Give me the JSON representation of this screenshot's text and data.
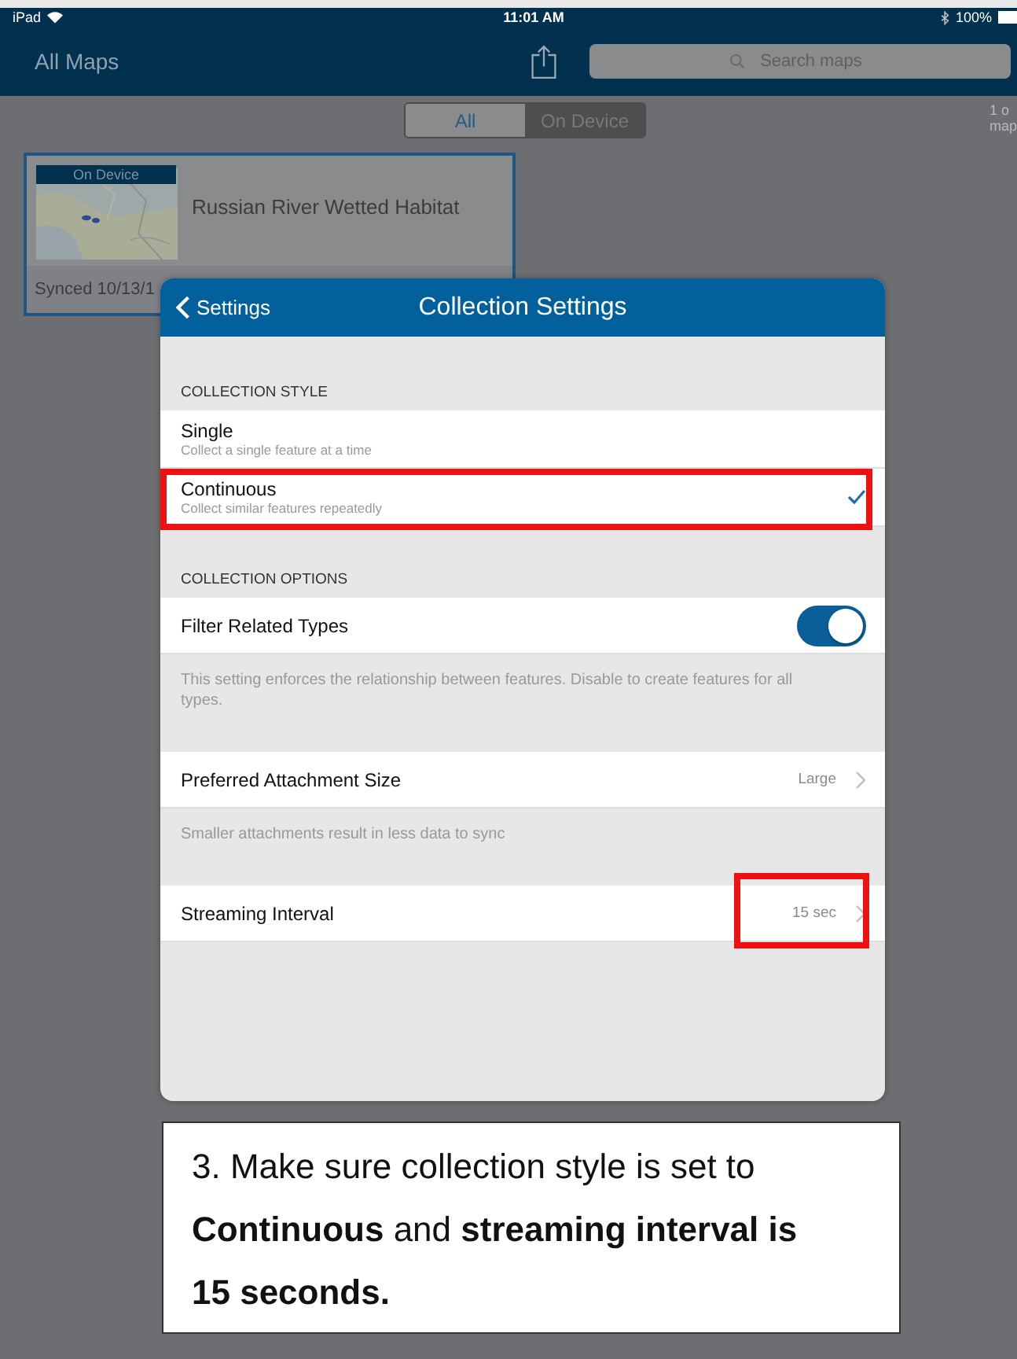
{
  "status_bar": {
    "device": "iPad",
    "time": "11:01 AM",
    "battery": "100%"
  },
  "nav_bar": {
    "title": "All Maps",
    "search": {
      "placeholder": "Search maps"
    }
  },
  "segments": [
    {
      "label": "All",
      "selected": true
    },
    {
      "label": "On Device",
      "selected": false
    }
  ],
  "side_note": [
    "1 o",
    "map"
  ],
  "map_card": {
    "badge": "On Device",
    "title": "Russian River Wetted Habitat",
    "synced": "Synced 10/13/1"
  },
  "dialog": {
    "back": "Settings",
    "title": "Collection Settings",
    "style_header": "COLLECTION STYLE",
    "styles": [
      {
        "label": "Single",
        "description": "Collect a single feature at a time",
        "selected": false,
        "highlighted": false
      },
      {
        "label": "Continuous",
        "description": "Collect similar features repeatedly",
        "selected": true,
        "highlighted": true
      }
    ],
    "options_header": "COLLECTION OPTIONS",
    "options": [
      {
        "kind": "toggle",
        "label": "Filter Related Types",
        "on": true,
        "note": "This setting enforces the relationship between features. Disable to create features for all types."
      },
      {
        "kind": "link",
        "label": "Preferred Attachment Size",
        "value": "Large",
        "highlighted": false,
        "note": "Smaller attachments result in less data to sync"
      },
      {
        "kind": "link",
        "label": "Streaming Interval",
        "value": "15 sec",
        "highlighted": true
      }
    ]
  },
  "caption": "3. Make sure collection style is set to **Continuous** and **streaming interval is 15 seconds.**"
}
